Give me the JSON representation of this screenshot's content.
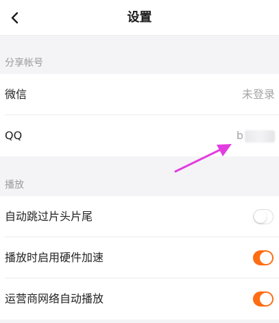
{
  "header": {
    "title": "设置",
    "back_icon": "chevron-left-icon"
  },
  "sections": {
    "share": {
      "title": "分享帐号",
      "wechat": {
        "label": "微信",
        "value": "未登录"
      },
      "qq": {
        "label": "QQ",
        "value": "b"
      }
    },
    "playback": {
      "title": "播放",
      "skip_intro": {
        "label": "自动跳过片头片尾",
        "enabled": false
      },
      "hw_accel": {
        "label": "播放时启用硬件加速",
        "enabled": true
      },
      "carrier_autoplay": {
        "label": "运营商网络自动播放",
        "enabled": true
      }
    }
  },
  "colors": {
    "accent": "#fd6d14",
    "annotation": "#e23ddf"
  }
}
